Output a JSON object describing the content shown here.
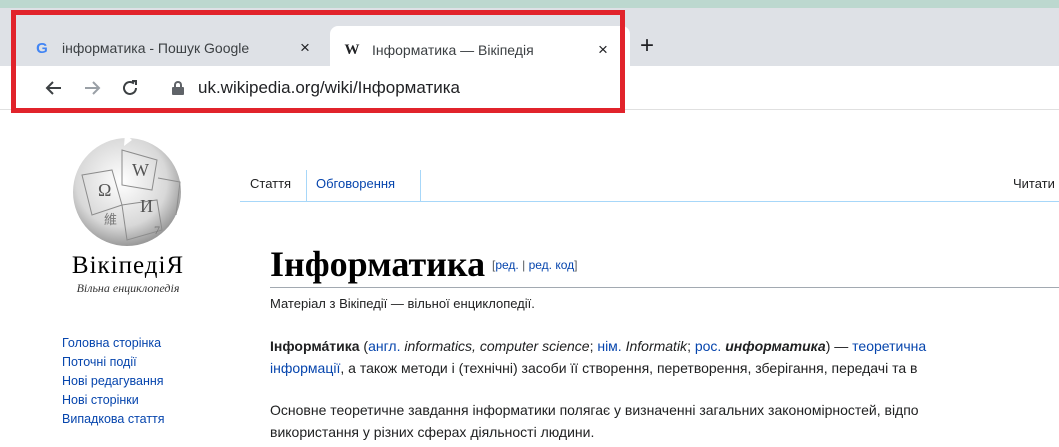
{
  "browser": {
    "tabs": [
      {
        "title": "інформатика - Пошук Google",
        "favicon": "google-icon",
        "active": false
      },
      {
        "title": "Інформатика — Вікіпедія",
        "favicon": "wikipedia-icon",
        "active": true
      }
    ],
    "favicon_g": "G",
    "favicon_w": "W",
    "close_glyph": "×",
    "new_tab_glyph": "+",
    "url": "uk.wikipedia.org/wiki/Інформатика",
    "highlight_color": "#e1232b"
  },
  "wiki": {
    "wordmark": "ВікіпедіЯ",
    "tagline": "Вільна енциклопедія",
    "nav": [
      "Головна сторінка",
      "Поточні події",
      "Нові редагування",
      "Нові сторінки",
      "Випадкова стаття"
    ],
    "tabs": {
      "article": "Стаття",
      "talk": "Обговорення",
      "read": "Читати"
    },
    "title": "Інформатика",
    "edit": {
      "open": "[",
      "edit": "ред.",
      "sep": " | ",
      "edit_code": "ред. код",
      "close": "]"
    },
    "from": "Матеріал з Вікіпедії — вільної енциклопедії.",
    "p1": {
      "term": "Інформа́тика",
      "a": " (",
      "eng": "англ.",
      "b": " ",
      "eng_terms": "informatics, computer science",
      "c": "; ",
      "ger": "нім.",
      "d": " ",
      "ger_term": "Informatik",
      "e": "; ",
      "rus": "рос.",
      "f": " ",
      "rus_term": "информатика",
      "g": ") — ",
      "tail": "теоретична"
    },
    "p1_line2_link": "інформації",
    "p1_line2_rest": ", а також методи і (технічні) засоби її створення, перетворення, зберігання, передачі та в",
    "p2_line1": "Основне теоретичне завдання інформатики полягає у визначенні загальних закономірностей, відпо",
    "p2_line2": "використання у різних сферах діяльності людини."
  }
}
